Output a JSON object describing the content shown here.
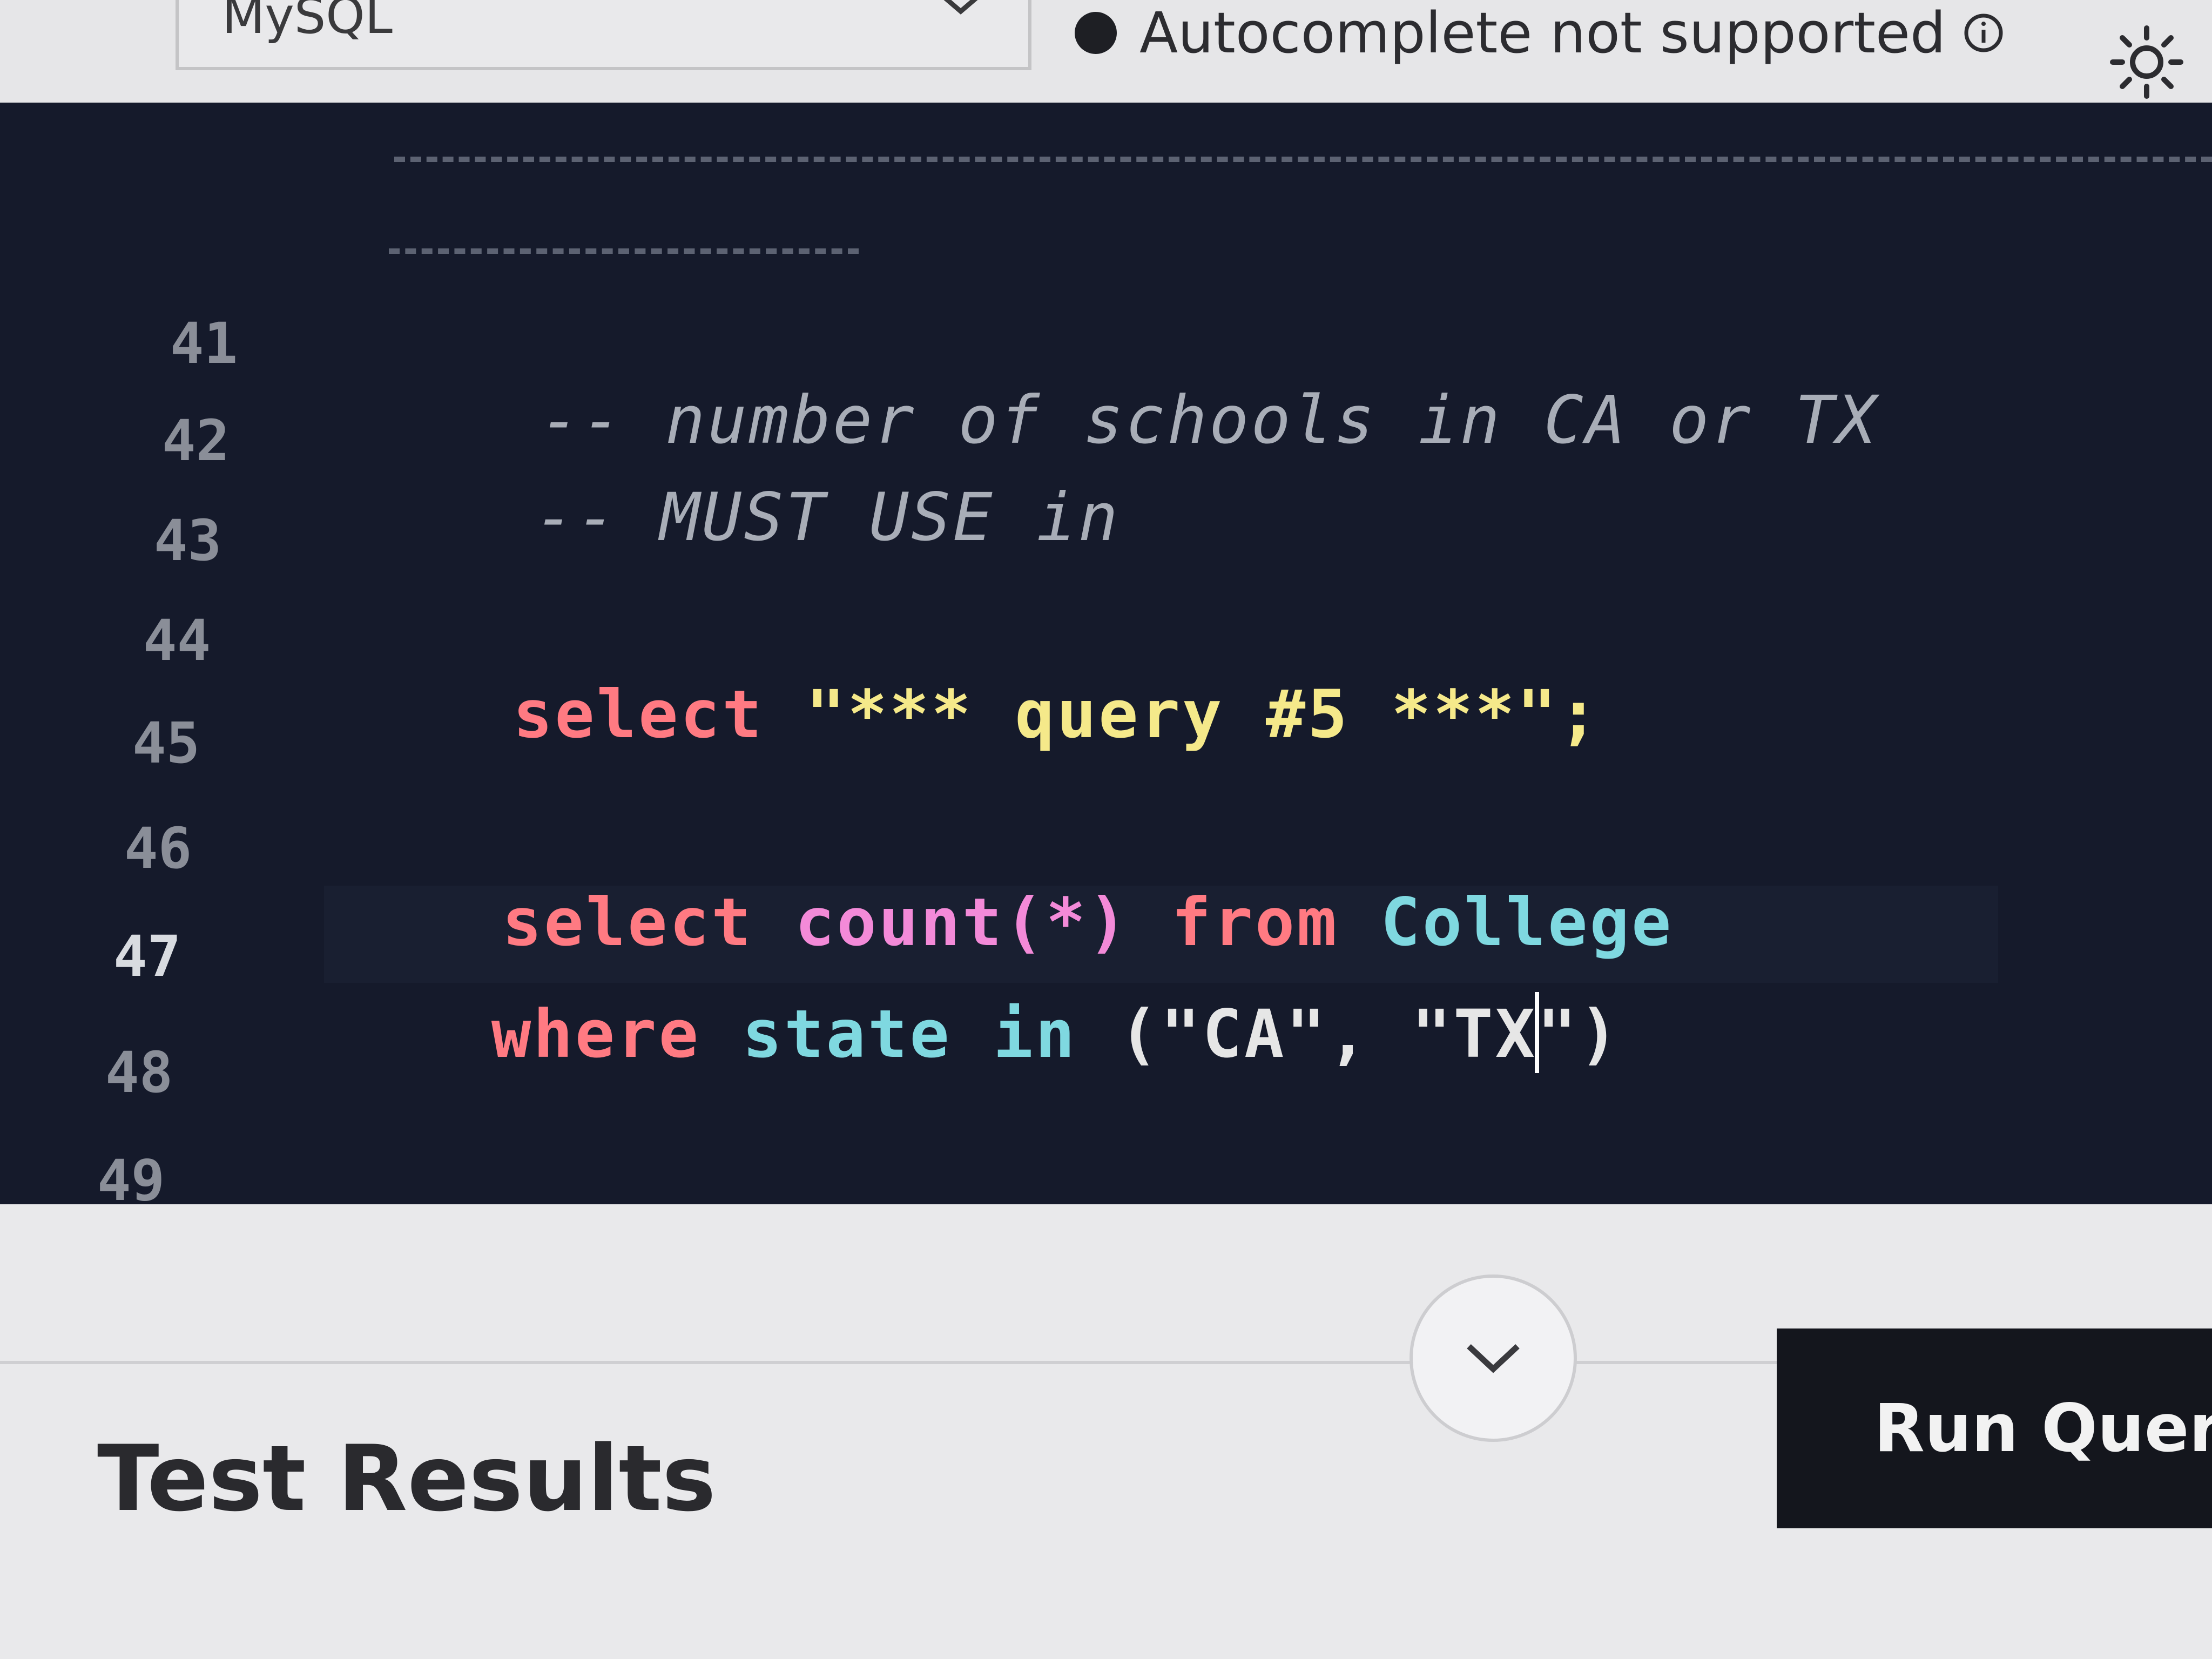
{
  "toolbar": {
    "language": "MySQL",
    "autocomplete_status": "Autocomplete not supported",
    "icons": [
      "chevron-down-icon",
      "status-dot-icon",
      "info-icon",
      "sun-icon"
    ]
  },
  "editor": {
    "lines": [
      {
        "number": "41",
        "text": "-- number of schools in CA or TX"
      },
      {
        "number": "42",
        "text": "-- MUST USE in"
      },
      {
        "number": "43",
        "text": ""
      },
      {
        "number": "44",
        "text": "select \"*** query #5 ***\";"
      },
      {
        "number": "45",
        "text": ""
      },
      {
        "number": "46",
        "text": "select count(*) from College"
      },
      {
        "number": "47",
        "text": "where state in (\"CA\", \"TX\")"
      },
      {
        "number": "48",
        "text": ""
      },
      {
        "number": "49",
        "text": "--"
      }
    ],
    "tokens": {
      "l41": "-- number of schools in CA or TX",
      "l42": "-- MUST USE in",
      "l44_kw": "select",
      "l44_str": "\"*** query #5 ***\";",
      "l46_kw": "select",
      "l46_fn": "count(*)",
      "l46_from": "from",
      "l46_table": "College",
      "l47_kw": "where",
      "l47_col": "state",
      "l47_in": "in",
      "l47_open": "(",
      "l47_ca": "\"CA\"",
      "l47_comma": ",",
      "l47_tx_a": "\"TX",
      "l47_tx_b": "\"",
      "l47_close": ")",
      "l49": "--"
    },
    "colors": {
      "background": "#151a2b",
      "keyword": "#ff7a82",
      "string": "#f5e98a",
      "function": "#f38ad8",
      "identifier": "#7fd8e0",
      "comment": "#a8adb7"
    }
  },
  "bottom": {
    "test_results_label": "Test Results",
    "run_query_label": "Run Query",
    "collapse_icon": "chevron-down-icon"
  }
}
